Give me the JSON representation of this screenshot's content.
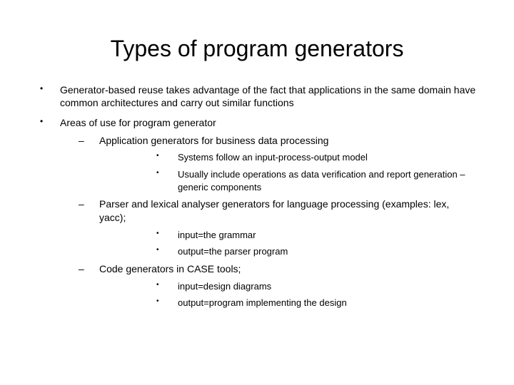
{
  "title": "Types of program generators",
  "bullets": [
    {
      "text": "Generator-based reuse takes advantage of the fact that applications in the same domain have common architectures and carry out similar functions"
    },
    {
      "text": "Areas of use for  program generator",
      "sub": [
        {
          "text": "Application generators for business data processing",
          "sub": [
            {
              "text": "Systems follow an input-process-output model"
            },
            {
              "text": "Usually include operations as data verification and report generation – generic components"
            }
          ]
        },
        {
          "text": "Parser and lexical analyser generators for language processing (examples: lex, yacc);",
          "sub": [
            {
              "text": "input=the grammar"
            },
            {
              "text": "output=the parser program"
            }
          ]
        },
        {
          "text": "Code generators in CASE tools;",
          "sub": [
            {
              "text": "input=design diagrams"
            },
            {
              "text": "output=program implementing the design"
            }
          ]
        }
      ]
    }
  ]
}
